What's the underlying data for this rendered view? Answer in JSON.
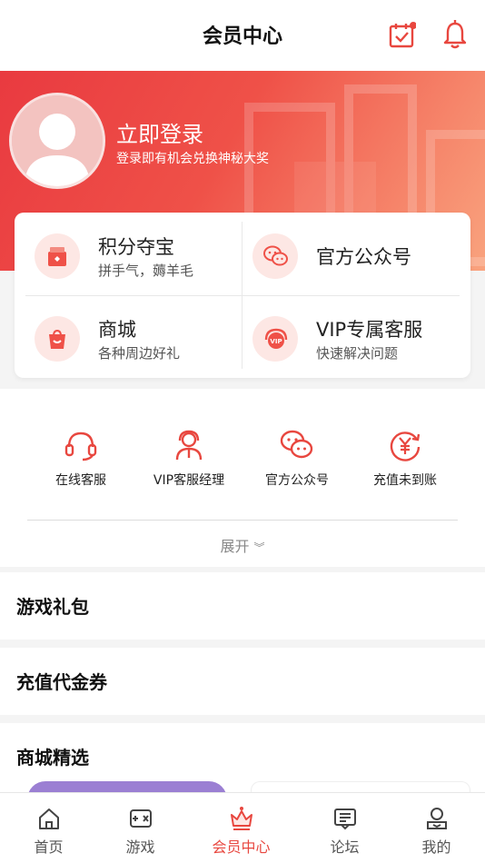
{
  "header": {
    "title": "会员中心"
  },
  "banner": {
    "login_title": "立即登录",
    "login_subtitle": "登录即有机会兑换神秘大奖"
  },
  "card": {
    "items": [
      {
        "title": "积分夺宝",
        "subtitle": "拼手气，薅羊毛",
        "icon": "gift-box-icon"
      },
      {
        "title": "官方公众号",
        "subtitle": "",
        "icon": "wechat-icon"
      },
      {
        "title": "商城",
        "subtitle": "各种周边好礼",
        "icon": "shopping-bag-icon"
      },
      {
        "title": "VIP专属客服",
        "subtitle": "快速解决问题",
        "icon": "vip-headset-icon"
      }
    ]
  },
  "services": {
    "items": [
      {
        "label": "在线客服",
        "icon": "headset-icon"
      },
      {
        "label": "VIP客服经理",
        "icon": "service-manager-icon"
      },
      {
        "label": "官方公众号",
        "icon": "wechat-icon"
      },
      {
        "label": "充值未到账",
        "icon": "yen-refresh-icon"
      }
    ],
    "expand_label": "展开"
  },
  "sections": {
    "gift": "游戏礼包",
    "voucher": "充值代金券",
    "mall": "商城精选"
  },
  "tabs": [
    {
      "label": "首页",
      "icon": "home-icon"
    },
    {
      "label": "游戏",
      "icon": "gamepad-icon"
    },
    {
      "label": "会员中心",
      "icon": "crown-icon",
      "active": true
    },
    {
      "label": "论坛",
      "icon": "forum-icon"
    },
    {
      "label": "我的",
      "icon": "profile-icon"
    }
  ],
  "colors": {
    "accent": "#e8473f",
    "banner_start": "#e93a40",
    "banner_end": "#f9a37e",
    "icon_bg": "#fde7e4"
  }
}
